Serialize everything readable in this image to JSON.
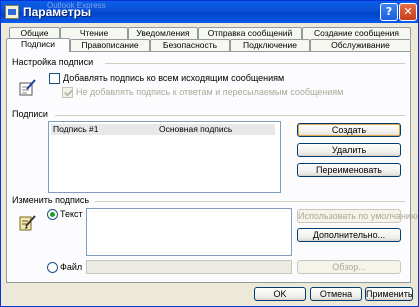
{
  "window": {
    "title": "Параметры",
    "ghost_title": "Outlook Express"
  },
  "titlebar": {
    "help_glyph": "?",
    "close_glyph": "✕"
  },
  "tabs_back": [
    "Общие",
    "Чтение",
    "Уведомления",
    "Отправка сообщений",
    "Создание сообщения"
  ],
  "tabs_front": [
    "Подписи",
    "Правописание",
    "Безопасность",
    "Подключение",
    "Обслуживание"
  ],
  "active_tab": "Подписи",
  "signature_settings": {
    "group_label": "Настройка подписи",
    "add_to_all_label": "Добавлять подпись ко всем исходящим сообщениям",
    "add_to_all_checked": false,
    "no_reply_label": "Не добавлять подпись к ответам и пересылаемым сообщениям",
    "no_reply_checked": true,
    "no_reply_enabled": false
  },
  "signatures": {
    "group_label": "Подписи",
    "list": [
      {
        "name": "Подпись #1",
        "status": "Основная подпись"
      }
    ],
    "buttons": {
      "create": "Создать",
      "delete": "Удалить",
      "rename": "Переименовать"
    }
  },
  "edit_signature": {
    "group_label": "Изменить подпись",
    "text_radio_label": "Текст",
    "text_radio_checked": true,
    "file_radio_label": "Файл",
    "file_radio_checked": false,
    "text_value": "",
    "file_value": "",
    "buttons": {
      "set_default": "Использовать по умолчанию",
      "advanced": "Дополнительно...",
      "browse": "Обзор..."
    }
  },
  "footer": {
    "ok": "OK",
    "cancel": "Отмена",
    "apply": "Применить"
  }
}
